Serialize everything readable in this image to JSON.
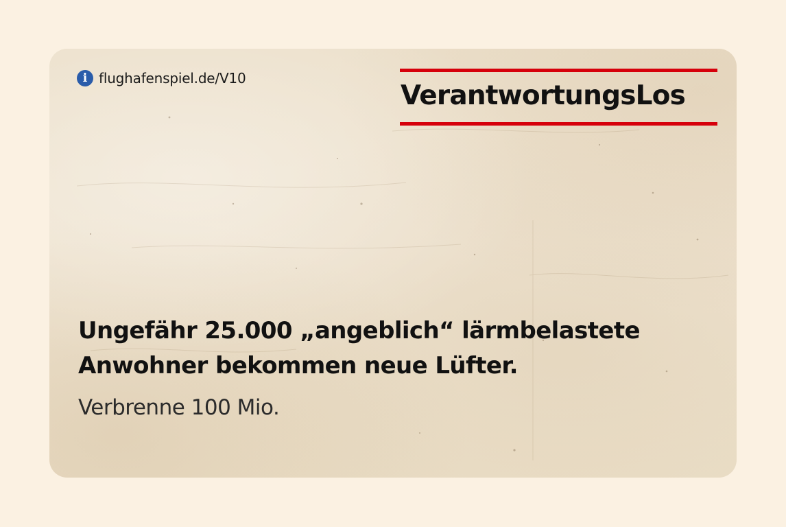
{
  "info": {
    "icon": "info-icon",
    "glyph": "i",
    "source": "flughafenspiel.de/V10"
  },
  "card": {
    "title": "VerantwortungsLos",
    "headline_line1": "Ungefähr 25.000 „angeblich“ lärmbelastete",
    "headline_line2": "Anwohner bekommen neue Lüfter.",
    "effect": "Verbrenne 100 Mio."
  },
  "colors": {
    "accent_red": "#d6000b",
    "info_blue": "#2a5caa",
    "page_background": "#fbf1e2",
    "card_paper": "#ede1cc"
  }
}
